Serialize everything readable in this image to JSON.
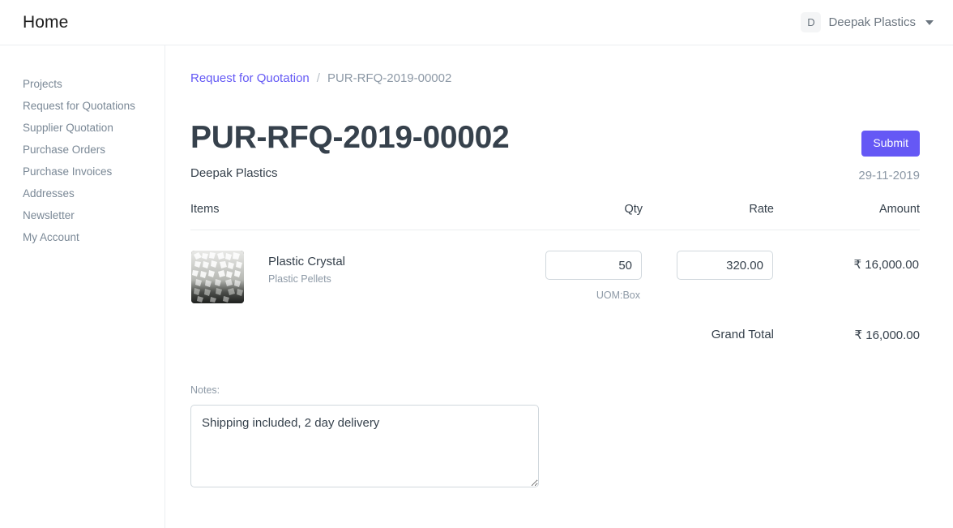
{
  "navbar": {
    "brand": "Home",
    "avatar_initial": "D",
    "user_name": "Deepak Plastics",
    "caret_icon": "chevron-down-icon"
  },
  "sidebar": {
    "items": [
      {
        "label": "Projects"
      },
      {
        "label": "Request for Quotations"
      },
      {
        "label": "Supplier Quotation"
      },
      {
        "label": "Purchase Orders"
      },
      {
        "label": "Purchase Invoices"
      },
      {
        "label": "Addresses"
      },
      {
        "label": "Newsletter"
      },
      {
        "label": "My Account"
      }
    ]
  },
  "breadcrumb": {
    "parent": "Request for Quotation",
    "separator": "/",
    "current": "PUR-RFQ-2019-00002"
  },
  "document": {
    "title": "PUR-RFQ-2019-00002",
    "supplier": "Deepak Plastics",
    "date": "29-11-2019",
    "submit_label": "Submit"
  },
  "items_table": {
    "headers": {
      "items": "Items",
      "qty": "Qty",
      "rate": "Rate",
      "amount": "Amount"
    },
    "rows": [
      {
        "image_alt": "plastic-crystal-thumbnail",
        "name": "Plastic Crystal",
        "description": "Plastic Pellets",
        "qty": "50",
        "qty_placeholder": "Qty",
        "rate": "320.00",
        "rate_placeholder": "Rate",
        "uom": "UOM:Box",
        "amount": "₹ 16,000.00"
      }
    ],
    "grand_total_label": "Grand Total",
    "grand_total_value": "₹ 16,000.00"
  },
  "notes": {
    "label": "Notes:",
    "value": "Shipping included, 2 day delivery",
    "placeholder": "Notes"
  },
  "colors": {
    "accent": "#6558f5",
    "link": "#6459f5",
    "text_dark": "#36414c",
    "text_muted": "#8d99a6",
    "border": "#ebeef0",
    "field_border": "#d1d8dd"
  }
}
